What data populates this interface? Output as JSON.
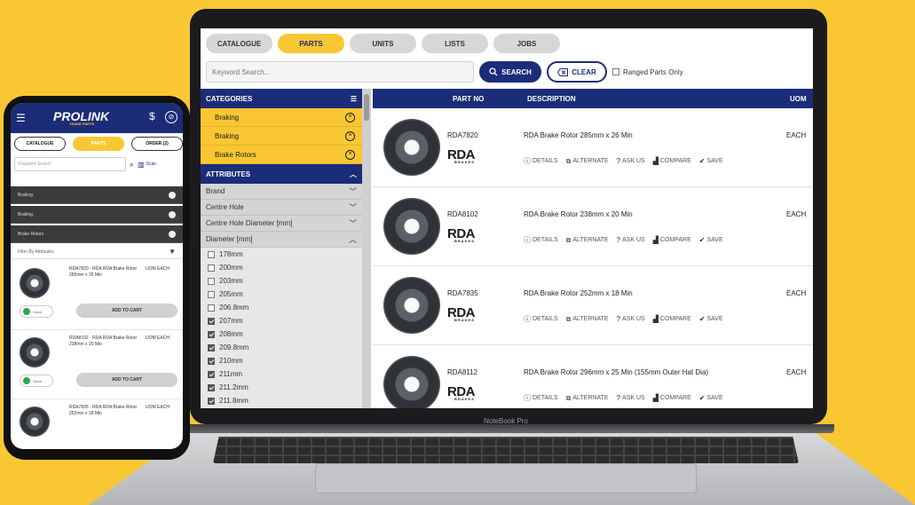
{
  "laptop": {
    "label": "NoteBook Pro",
    "tabs": [
      {
        "label": "CATALOGUE",
        "active": false
      },
      {
        "label": "PARTS",
        "active": true
      },
      {
        "label": "UNITS",
        "active": false
      },
      {
        "label": "LISTS",
        "active": false
      },
      {
        "label": "JOBS",
        "active": false
      }
    ],
    "search": {
      "placeholder": "Keyword Search...",
      "search_label": "SEARCH",
      "clear_label": "CLEAR",
      "ranged_label": "Ranged Parts Only"
    },
    "sidebar": {
      "categories_title": "CATEGORIES",
      "categories": [
        "Braking",
        "Braking",
        "Brake Rotors"
      ],
      "attributes_title": "ATTRIBUTES",
      "attributes": [
        "Brand",
        "Centre Hole",
        "Centre Hole Diameter [mm]",
        "Diameter [mm]"
      ],
      "diameter_options": [
        {
          "label": "178mm",
          "checked": false
        },
        {
          "label": "200mm",
          "checked": false
        },
        {
          "label": "203mm",
          "checked": false
        },
        {
          "label": "205mm",
          "checked": false
        },
        {
          "label": "206.8mm",
          "checked": false
        },
        {
          "label": "207mm",
          "checked": true
        },
        {
          "label": "208mm",
          "checked": true
        },
        {
          "label": "209.8mm",
          "checked": true
        },
        {
          "label": "210mm",
          "checked": true
        },
        {
          "label": "211mm",
          "checked": true
        },
        {
          "label": "211.2mm",
          "checked": true
        },
        {
          "label": "211.8mm",
          "checked": true
        }
      ]
    },
    "results": {
      "columns": {
        "part_no": "PART NO",
        "description": "DESCRIPTION",
        "uom": "UOM"
      },
      "brand": "RDA",
      "brand_sub": "BRAKES",
      "actions": {
        "details": "DETAILS",
        "alternate": "ALTERNATE",
        "ask_us": "ASK US",
        "compare": "COMPARE",
        "save": "SAVE"
      },
      "rows": [
        {
          "part_no": "RDA7820",
          "description": "RDA Brake Rotor 285mm x 26 Min",
          "uom": "EACH"
        },
        {
          "part_no": "RDA8102",
          "description": "RDA Brake Rotor 238mm x 20 Min",
          "uom": "EACH"
        },
        {
          "part_no": "RDA7835",
          "description": "RDA Brake Rotor 252mm x 18 Min",
          "uom": "EACH"
        },
        {
          "part_no": "RDA8112",
          "description": "RDA Brake Rotor 296mm x 25 Min (155mm Outer Hat Dia)",
          "uom": "EACH"
        }
      ]
    }
  },
  "phone": {
    "logo": "PROLINK",
    "logo_sub": "TRADE PARTS",
    "dollar": "$",
    "tabs": [
      {
        "label": "CATALOGUE",
        "active": false
      },
      {
        "label": "PARTS",
        "active": true
      },
      {
        "label": "ORDER (2)",
        "active": false
      }
    ],
    "search_placeholder": "Keyword Search",
    "scan_label": "Scan",
    "categories": [
      "Braking",
      "Braking",
      "Brake Rotors"
    ],
    "filter_label": "Filter By Attributes",
    "uom_label": "UOM EACH",
    "stock_label": "Stock",
    "cart_label": "ADD TO CART",
    "items": [
      {
        "title": "RDA7820 - RDA RDA Brake Rotor 285mm x 26 Min"
      },
      {
        "title": "RDA8102 - RDA RDA Brake Rotor 238mm x 20 Min"
      },
      {
        "title": "RDA7835 - RDA RDA Brake Rotor 252mm x 18 Min"
      }
    ]
  },
  "colors": {
    "brand_navy": "#1b2c78",
    "brand_yellow": "#f9c733"
  }
}
